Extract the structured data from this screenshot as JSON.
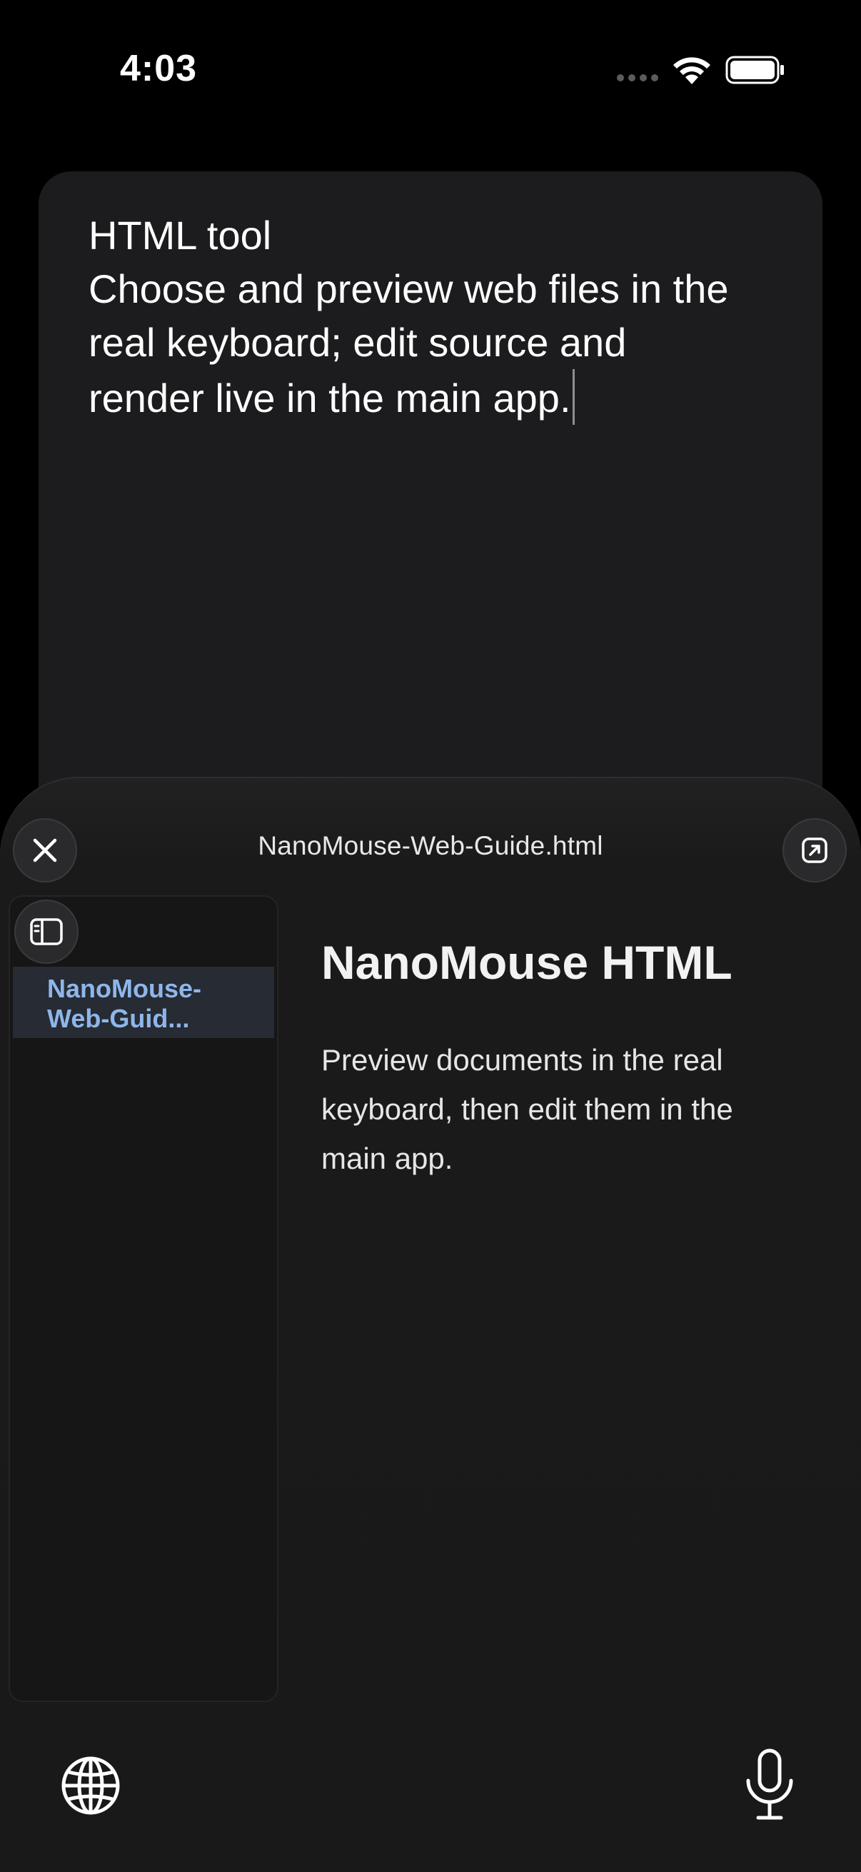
{
  "status_bar": {
    "time": "4:03"
  },
  "editor": {
    "lines": [
      "HTML tool",
      "Choose and preview web files in the",
      "real keyboard; edit source and",
      "render live in the main app."
    ]
  },
  "sheet": {
    "title": "NanoMouse-Web-Guide.html",
    "close_icon": "close-icon",
    "expand_icon": "open-external-icon"
  },
  "sidebar": {
    "toggle_icon": "sidebar-icon",
    "items": [
      {
        "label_line1": "NanoMouse-",
        "label_line2": "Web-Guid..."
      }
    ]
  },
  "preview": {
    "heading": "NanoMouse HTML",
    "body_lines": [
      "Preview documents in the real",
      "keyboard, then edit them in the",
      "main app."
    ]
  },
  "keyboard_bar": {
    "globe_icon": "globe-icon",
    "mic_icon": "microphone-icon"
  },
  "colors": {
    "background": "#000000",
    "card": "#1c1c1e",
    "sheet": "#1a1a1a",
    "sidebar_selected": "#262b34",
    "link_accent": "#8fb6ea"
  }
}
